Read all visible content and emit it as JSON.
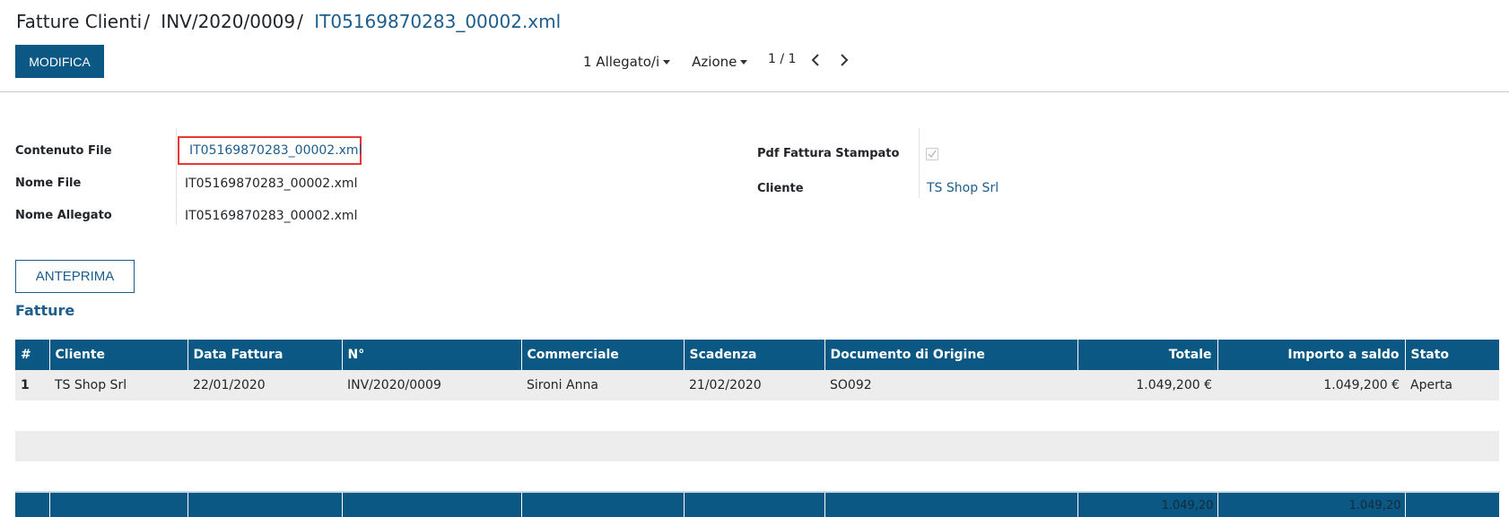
{
  "breadcrumb": {
    "items": [
      "Fatture Clienti",
      "INV/2020/0009"
    ],
    "separator": "/",
    "active": "IT05169870283_00002.xml"
  },
  "toolbar": {
    "edit_label": "MODIFICA",
    "attachments_label": "1 Allegato/i",
    "action_label": "Azione",
    "pager_value": "1 / 1"
  },
  "form": {
    "file_content_label": "Contenuto File",
    "file_content_value": "IT05169870283_00002.xml",
    "file_name_label": "Nome File",
    "file_name_value": "IT05169870283_00002.xml",
    "attachment_name_label": "Nome Allegato",
    "attachment_name_value": "IT05169870283_00002.xml",
    "pdf_printed_label": "Pdf Fattura Stampato",
    "pdf_printed_checked": true,
    "customer_label": "Cliente",
    "customer_value": "TS Shop Srl"
  },
  "preview_label": "ANTEPRIMA",
  "invoices": {
    "title": "Fatture",
    "columns": [
      "#",
      "Cliente",
      "Data Fattura",
      "N°",
      "Commerciale",
      "Scadenza",
      "Documento di Origine",
      "Totale",
      "Importo a saldo",
      "Stato"
    ],
    "rows": [
      [
        "1",
        "TS Shop Srl",
        "22/01/2020",
        "INV/2020/0009",
        "Sironi Anna",
        "21/02/2020",
        "SO092",
        "1.049,200 €",
        "1.049,200 €",
        "Aperta"
      ]
    ],
    "footer_total": "1.049,20",
    "footer_residual": "1.049,20"
  },
  "colors": {
    "primary": "#0a5883",
    "link": "#1d5d8c",
    "highlight_border": "#e53935"
  }
}
